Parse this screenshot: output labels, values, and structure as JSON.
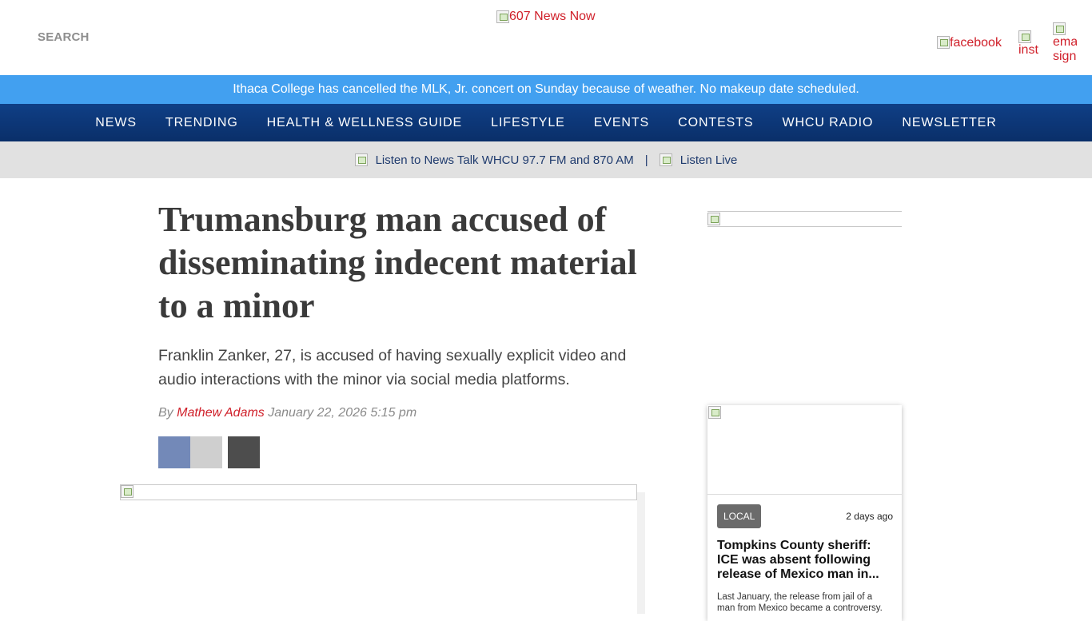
{
  "header": {
    "search_label": "SEARCH",
    "logo_alt": "607 News Now",
    "social": {
      "facebook_alt": "facebook",
      "instagram_alt": "inst",
      "email_alt_line1": "ema",
      "email_alt_line2": "sign"
    }
  },
  "alert": {
    "text": "Ithaca College has cancelled the MLK, Jr. concert on Sunday because of weather. No makeup date scheduled."
  },
  "nav": {
    "items": [
      "NEWS",
      "TRENDING",
      "HEALTH & WELLNESS GUIDE",
      "LIFESTYLE",
      "EVENTS",
      "CONTESTS",
      "WHCU RADIO",
      "NEWSLETTER"
    ]
  },
  "listen": {
    "station_text": "Listen to News Talk WHCU 97.7 FM and 870 AM",
    "separator": "|",
    "live_text": "Listen Live"
  },
  "article": {
    "headline": "Trumansburg man accused of disseminating indecent material to a minor",
    "dek": "Franklin Zanker, 27, is accused of having sexually explicit video and audio interactions with the minor via social media platforms.",
    "byline_prefix": "By",
    "author": "Mathew Adams",
    "date": "January 22, 2026 5:15 pm"
  },
  "sidebar": {
    "card": {
      "category": "LOCAL",
      "time": "2 days ago",
      "title": "Tompkins County sheriff: ICE was absent following release of Mexico man in...",
      "excerpt": "Last January, the release from jail of a man from Mexico became a controversy."
    }
  },
  "colors": {
    "accent_red": "#d0202a",
    "alert_blue": "#42a0f0",
    "nav_navy": "#0f3f86",
    "listen_bar_gray": "#e1e1e1"
  }
}
